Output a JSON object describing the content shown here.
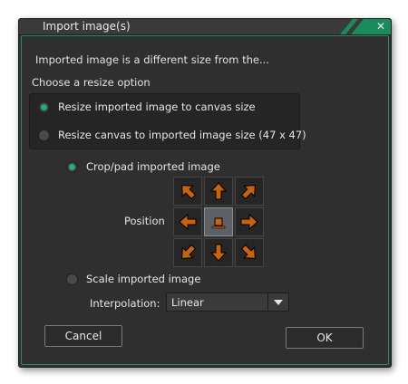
{
  "window": {
    "title": "Import image(s)",
    "close_label": "✕",
    "accent_color": "#1a8a5f"
  },
  "info": "Imported image is a different size from the...",
  "resize": {
    "heading": "Choose a resize option",
    "options": [
      {
        "label": "Resize imported image to canvas size",
        "selected": true
      },
      {
        "label": "Resize canvas to imported image size (47 x 47)",
        "selected": false
      }
    ]
  },
  "mode": {
    "crop_label": "Crop/pad imported image",
    "crop_selected": true,
    "position_label": "Position",
    "position_cells": [
      "arrow-up-left-icon",
      "arrow-up-icon",
      "arrow-up-right-icon",
      "arrow-left-icon",
      "anchor-center-icon",
      "arrow-right-icon",
      "arrow-down-left-icon",
      "arrow-down-icon",
      "arrow-down-right-icon"
    ],
    "selected_position": "center",
    "scale_label": "Scale imported image",
    "scale_selected": false
  },
  "interpolation": {
    "label": "Interpolation:",
    "value": "Linear",
    "dropdown_icon": "dropdown-arrow-icon"
  },
  "buttons": {
    "cancel": "Cancel",
    "ok": "OK"
  },
  "colors": {
    "arrow": "#c8620c",
    "radio_on": "#1fb07a",
    "frame": "#2a8a66"
  }
}
